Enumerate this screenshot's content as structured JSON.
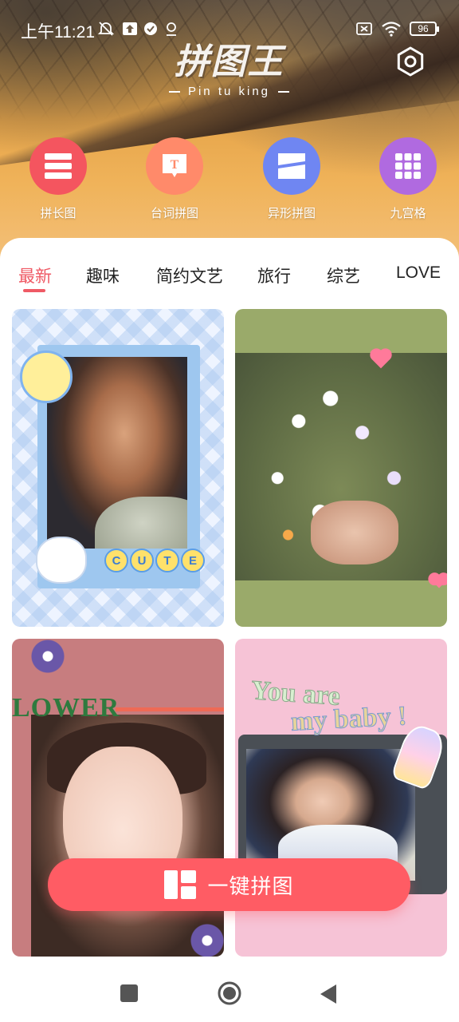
{
  "status_bar": {
    "time": "上午11:21",
    "battery": "96"
  },
  "header": {
    "logo_title": "拼图王",
    "logo_subtitle": "Pin tu king"
  },
  "tools": [
    {
      "label": "拼长图",
      "icon": "long-stitch-icon",
      "color": "#f4555f"
    },
    {
      "label": "台词拼图",
      "icon": "subtitle-stitch-icon",
      "color": "#ff8a6a"
    },
    {
      "label": "异形拼图",
      "icon": "shaped-collage-icon",
      "color": "#6f86f2"
    },
    {
      "label": "九宫格",
      "icon": "grid-nine-icon",
      "color": "#b06ae0"
    }
  ],
  "tabs": [
    "最新",
    "趣味",
    "简约文艺",
    "旅行",
    "综艺",
    "LOVE"
  ],
  "active_tab": "最新",
  "templates": [
    {
      "sticker_text": "CUTE"
    },
    {
      "sticker_text": ""
    },
    {
      "sticker_text": "LOWER"
    },
    {
      "sticker_text_line1": "You are",
      "sticker_text_line2": "my baby !"
    }
  ],
  "fab": {
    "label": "一键拼图",
    "icon": "collage-layout-icon"
  },
  "colors": {
    "accent": "#ef5a65",
    "fab": "#ff5c64"
  }
}
